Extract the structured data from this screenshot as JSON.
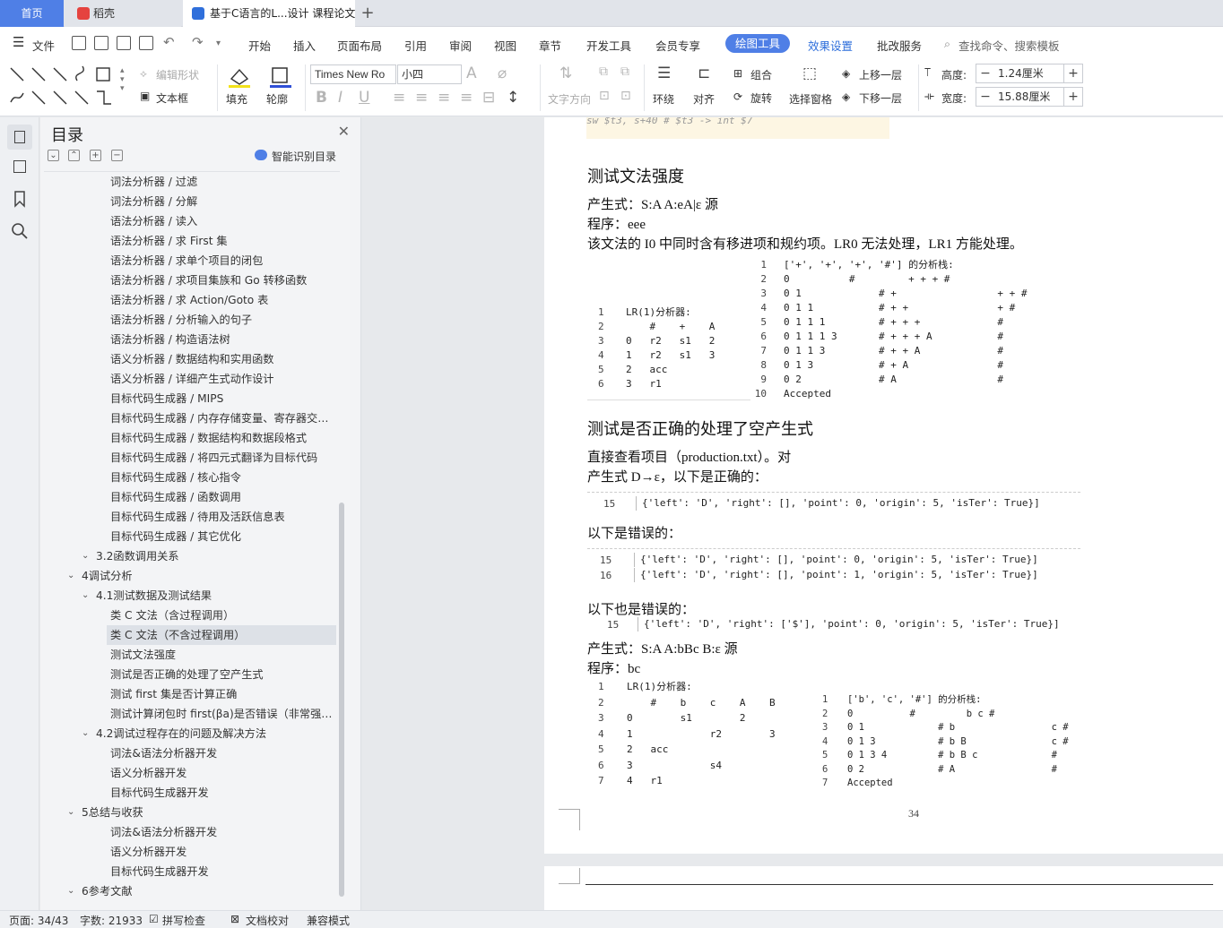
{
  "tabs": [
    {
      "label": "首页"
    },
    {
      "label": "稻壳"
    },
    {
      "label": "基于C语言的L...设计 课程论文"
    }
  ],
  "menu": {
    "file": "文件",
    "items": [
      "开始",
      "插入",
      "页面布局",
      "引用",
      "审阅",
      "视图",
      "章节",
      "开发工具",
      "会员专享"
    ],
    "active": "绘图工具",
    "extra": [
      "效果设置",
      "批改服务"
    ],
    "search": "查找命令、搜索模板"
  },
  "toolbar": {
    "edit_shape": "编辑形状",
    "textbox": "文本框",
    "fill": "填充",
    "outline": "轮廓",
    "font_name": "Times New Ro",
    "font_size": "小四",
    "text_dir": "文字方向",
    "wrap": "环绕",
    "align": "对齐",
    "group": "组合",
    "rotate": "旋转",
    "select_pane": "选择窗格",
    "bring_up": "上移一层",
    "send_down": "下移一层",
    "height_label": "高度:",
    "height_value": "1.24厘米",
    "width_label": "宽度:",
    "width_value": "15.88厘米"
  },
  "toc": {
    "title": "目录",
    "smart": "智能识别目录",
    "items": [
      {
        "label": "词法分析器 / 过滤",
        "level": 3
      },
      {
        "label": "词法分析器 / 分解",
        "level": 3
      },
      {
        "label": "语法分析器 / 读入",
        "level": 3
      },
      {
        "label": "语法分析器 / 求 First 集",
        "level": 3
      },
      {
        "label": "语法分析器 / 求单个项目的闭包",
        "level": 3
      },
      {
        "label": "语法分析器 / 求项目集族和 Go 转移函数",
        "level": 3
      },
      {
        "label": "语法分析器 / 求 Action/Goto 表",
        "level": 3
      },
      {
        "label": "语法分析器 / 分析输入的句子",
        "level": 3
      },
      {
        "label": "语法分析器 / 构造语法树",
        "level": 3
      },
      {
        "label": "语义分析器 / 数据结构和实用函数",
        "level": 3
      },
      {
        "label": "语义分析器 / 详细产生式动作设计",
        "level": 3
      },
      {
        "label": "目标代码生成器 / MIPS",
        "level": 3
      },
      {
        "label": "目标代码生成器 / 内存存储变量、寄存器交…",
        "level": 3
      },
      {
        "label": "目标代码生成器 / 数据结构和数据段格式",
        "level": 3
      },
      {
        "label": "目标代码生成器 / 将四元式翻译为目标代码",
        "level": 3
      },
      {
        "label": "目标代码生成器 / 核心指令",
        "level": 3
      },
      {
        "label": "目标代码生成器 / 函数调用",
        "level": 3
      },
      {
        "label": "目标代码生成器 / 待用及活跃信息表",
        "level": 3
      },
      {
        "label": "目标代码生成器 / 其它优化",
        "level": 3
      },
      {
        "label": "3.2函数调用关系",
        "level": 2
      },
      {
        "label": "4调试分析",
        "level": 1
      },
      {
        "label": "4.1测试数据及测试结果",
        "level": 2
      },
      {
        "label": "类 C 文法（含过程调用）",
        "level": 3
      },
      {
        "label": "类 C 文法（不含过程调用）",
        "level": 3
      },
      {
        "label": "测试文法强度",
        "level": 3
      },
      {
        "label": "测试是否正确的处理了空产生式",
        "level": 3
      },
      {
        "label": "测试 first 集是否计算正确",
        "level": 3
      },
      {
        "label": "测试计算闭包时 first(βa)是否错误（非常强…",
        "level": 3
      },
      {
        "label": "4.2调试过程存在的问题及解决方法",
        "level": 2
      },
      {
        "label": "词法&语法分析器开发",
        "level": 3
      },
      {
        "label": "语义分析器开发",
        "level": 3
      },
      {
        "label": "目标代码生成器开发",
        "level": 3
      },
      {
        "label": "5总结与收获",
        "level": 1
      },
      {
        "label": "词法&语法分析器开发",
        "level": 3
      },
      {
        "label": "语义分析器开发",
        "level": 3
      },
      {
        "label": "目标代码生成器开发",
        "level": 3
      },
      {
        "label": "6参考文献",
        "level": 1
      }
    ]
  },
  "doc": {
    "top_code": "sw $t3, s+40 # $t3 -> int $7",
    "h_strength": "测试文法强度",
    "p_prod1": "产生式：S:A   A:eA|ε 源",
    "p_prog1": "程序：eee",
    "p_lr": "该文法的 I0 中同时含有移进项和规约项。LR0 无法处理，LR1 方能处理。",
    "lr1_table": {
      "lines": [
        "LR(1)分析器:",
        "    #    +    A",
        "0   r2   s1   2",
        "1   r2   s1   3",
        "2   acc",
        "3   r1"
      ],
      "nums": [
        "1",
        "2",
        "3",
        "4",
        "5",
        "6"
      ]
    },
    "stack1": {
      "lines": [
        "['+', '+', '+', '#'] 的分析栈:",
        "0          #         + + + #",
        "0 1             # +                 + + #",
        "0 1 1           # + +               + #",
        "0 1 1 1         # + + +             #",
        "0 1 1 1 3       # + + + A           #",
        "0 1 1 3         # + + A             #",
        "0 1 3           # + A               #",
        "0 2             # A                 #",
        "Accepted"
      ],
      "nums": [
        "1",
        "2",
        "3",
        "4",
        "5",
        "6",
        "7",
        "8",
        "9",
        "10"
      ]
    },
    "h_empty": "测试是否正确的处理了空产生式",
    "p_direct": "直接查看项目（production.txt）。对",
    "p_prod_d": "产生式 D→ε，以下是正确的：",
    "correct_line": {
      "num": "15",
      "text": "{'left': 'D', 'right': [], 'point': 0, 'origin': 5, 'isTer': True}]"
    },
    "p_wrong1": "以下是错误的：",
    "wrong_lines": [
      {
        "num": "15",
        "text": "{'left': 'D', 'right': [], 'point': 0, 'origin': 5, 'isTer': True}]"
      },
      {
        "num": "16",
        "text": "{'left': 'D', 'right': [], 'point': 1, 'origin': 5, 'isTer': True}]"
      }
    ],
    "p_wrong2": "以下也是错误的：",
    "wrong_line2": {
      "num": "15",
      "text": "{'left': 'D', 'right': ['$'], 'point': 0, 'origin': 5, 'isTer': True}]"
    },
    "p_prod2": "产生式：S:A   A:bBc   B:ε 源",
    "p_prog2": "程序：bc",
    "lr1_table2": {
      "lines": [
        "LR(1)分析器:",
        "    #    b    c    A    B",
        "0        s1        2",
        "1             r2        3",
        "2   acc",
        "3             s4",
        "4   r1"
      ],
      "nums": [
        "1",
        "2",
        "3",
        "4",
        "5",
        "6",
        "7"
      ]
    },
    "stack2": {
      "lines": [
        "['b', 'c', '#'] 的分析栈:",
        "0          #         b c #",
        "0 1             # b                 c #",
        "0 1 3           # b B               c #",
        "0 1 3 4         # b B c             #",
        "0 2             # A                 #",
        "Accepted"
      ],
      "nums": [
        "1",
        "2",
        "3",
        "4",
        "5",
        "6",
        "7"
      ]
    },
    "page_number": "34"
  },
  "status": {
    "page": "页面: 34/43",
    "words": "字数: 21933",
    "spell": "拼写检查",
    "proof": "文档校对",
    "compat": "兼容模式"
  },
  "colors": {
    "accent": "#4f7fe6",
    "wps_red": "#e5433f",
    "doc_blue": "#2f6fdb"
  }
}
